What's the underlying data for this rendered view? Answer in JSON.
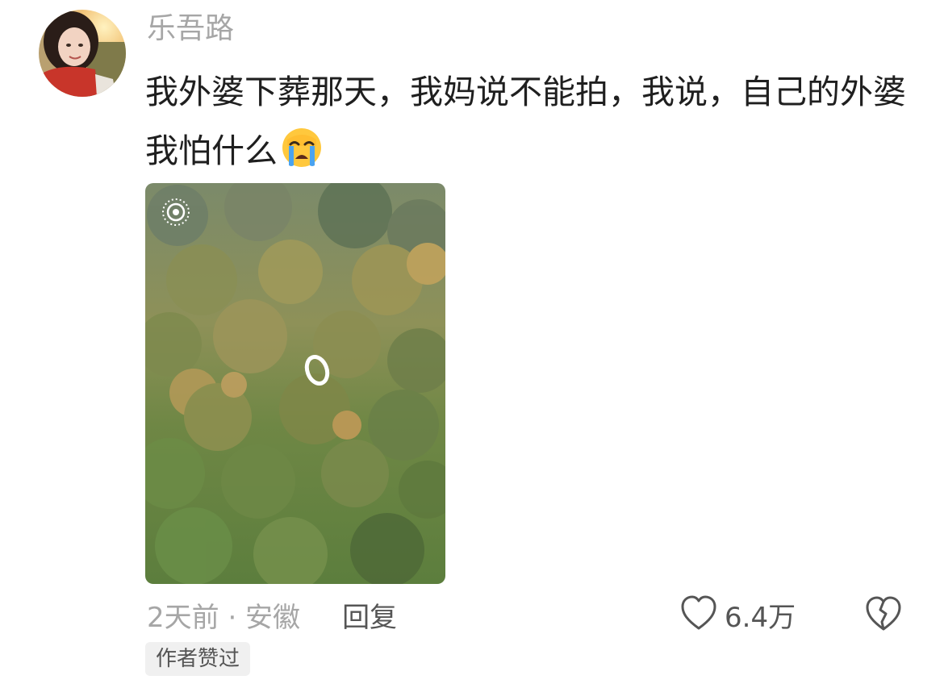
{
  "comment": {
    "username": "乐吾路",
    "text": "我外婆下葬那天，我妈说不能拍，我说，自己的外婆我怕什么",
    "emoji": "loudly-crying-face",
    "image_overlay_icon": "live-photo-icon",
    "time_location": "2天前 · 安徽",
    "reply_label": "回复",
    "like_count": "6.4万",
    "author_badge": "作者赞过"
  },
  "icons": {
    "like": "heart-icon",
    "dislike": "broken-heart-icon"
  },
  "colors": {
    "username": "#a6a6a6",
    "text": "#1f1f1f",
    "meta": "#a6a6a6",
    "badge_bg": "#f0f0f0"
  }
}
